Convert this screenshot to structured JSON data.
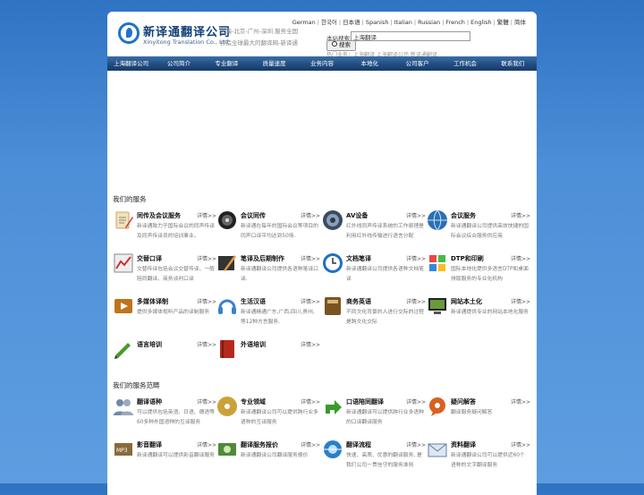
{
  "header": {
    "logo_cn": "新译通翻译公司",
    "logo_en": "Xinyitong Translation Co., Ltd",
    "slogan1": "上海-北京-广州-深圳 服务全国",
    "slogan2": "打造全球最大的翻译网-新译通",
    "languages": [
      "German",
      "한국어",
      "日本语",
      "Spanish",
      "Italian",
      "Russian",
      "French",
      "English",
      "繁體",
      "简体"
    ],
    "search_label": "本站搜索:",
    "search_value": "上海翻译",
    "search_button": "搜索",
    "hot_text": "热门业务：上海翻译 上海翻译公司 新译通翻译"
  },
  "nav": [
    "上海翻译公司",
    "公司简介",
    "专业翻译",
    "质量速度",
    "业务内容",
    "本地化",
    "公司客户",
    "工作机会",
    "联系我们"
  ],
  "sections": [
    {
      "title": "我们的服务",
      "items": [
        {
          "title": "同传及会议服务",
          "more": "详情>>",
          "desc": "新译通致力于国际会议的同声传译及同声传译员的培训事业。",
          "icon": "clipboard-icon",
          "color": "#c9a36a"
        },
        {
          "title": "会议同传",
          "more": "详情>>",
          "desc": "新译通在每年的国际会议等项目的同声口译平均达到50场.",
          "icon": "headset-icon",
          "color": "#444444"
        },
        {
          "title": "AV设备",
          "more": "详情>>",
          "desc": "红外线同声传译系统的工作原理是利用红外线传输进行语言分配",
          "icon": "speaker-icon",
          "color": "#5a6c80"
        },
        {
          "title": "会议服务",
          "more": "详情>>",
          "desc": "新译通翻译公司提供高效快捷的国际会议综合服务供应商",
          "icon": "globe-icon",
          "color": "#2a6fb5"
        },
        {
          "title": "交替口译",
          "more": "详情>>",
          "desc": "交替传译包括会议交替传译、一般陪同翻译、商务谈判口译",
          "icon": "chart-icon",
          "color": "#777777"
        },
        {
          "title": "笔译及后期制作",
          "more": "详情>>",
          "desc": "新译通翻译公司提供各语种笔译口译.",
          "icon": "pen-icon",
          "color": "#3b3b3b"
        },
        {
          "title": "文档笔译",
          "more": "详情>>",
          "desc": "新译通翻译公司提供各语种文档笔译",
          "icon": "clock-icon",
          "color": "#1e6ec8"
        },
        {
          "title": "DTP和印刷",
          "more": "详情>>",
          "desc": "国际本地化提供多语言DTP和桌面排版服务的专业化机构",
          "icon": "windows-icon",
          "color": "#2a66c7"
        },
        {
          "title": "多媒体译制",
          "more": "详情>>",
          "desc": "提供多媒体视听产品的译制服务",
          "icon": "media-icon",
          "color": "#c0731f"
        },
        {
          "title": "生活汉语",
          "more": "详情>>",
          "desc": "新译通精通广东,广西,四川,贵州,等12种方言服务.",
          "icon": "headphones-icon",
          "color": "#3a82c9"
        },
        {
          "title": "商务英语",
          "more": "详情>>",
          "desc": "不同文化背景的人进行交际的过程是跨文化交际",
          "icon": "book-icon",
          "color": "#7b5321"
        },
        {
          "title": "网站本土化",
          "more": "详情>>",
          "desc": "新译通提供专业的网站本地化服务",
          "icon": "computer-icon",
          "color": "#3f5f1f"
        },
        {
          "title": "语言培训",
          "more": "详情>>",
          "desc": "",
          "icon": "pencil-icon",
          "color": "#4a9a2b"
        },
        {
          "title": "外语培训",
          "more": "详情>>",
          "desc": "",
          "icon": "redbook-icon",
          "color": "#b52a1f"
        }
      ]
    },
    {
      "title": "我们的服务范畴",
      "items": [
        {
          "title": "翻译语种",
          "more": "详情>>",
          "desc": "可以提供包括英语、日语、德语等60多种外国语种的互译服务",
          "icon": "people-icon",
          "color": "#6f8aa8"
        },
        {
          "title": "专业领域",
          "more": "详情>>",
          "desc": "新译通翻译公司可以提供跨行业多语种的互译服务",
          "icon": "cd-icon",
          "color": "#c9a33a"
        },
        {
          "title": "口语陪同翻译",
          "more": "详情>>",
          "desc": "新译通翻译可以提供跨行业多语种的口译翻译服务",
          "icon": "arrow-icon",
          "color": "#3a9a2b"
        },
        {
          "title": "疑问解答",
          "more": "详情>>",
          "desc": "翻译服务疑问解答",
          "icon": "chat-icon",
          "color": "#d9621f"
        },
        {
          "title": "影音翻译",
          "more": "详情>>",
          "desc": "新译通翻译可以提供影音翻译服务",
          "icon": "film-icon",
          "color": "#8a6a3a"
        },
        {
          "title": "翻译服务报价",
          "more": "详情>>",
          "desc": "新译通翻译公司翻译服务报价",
          "icon": "money-icon",
          "color": "#4f8a3a"
        },
        {
          "title": "翻译流程",
          "more": "详情>>",
          "desc": "快速、高质、优惠的翻译服务, 是我们公司一贯信守的服务准则",
          "icon": "network-icon",
          "color": "#2a7fc9"
        },
        {
          "title": "资料翻译",
          "more": "详情>>",
          "desc": "新译通翻译公司可以提供近60个语种的文字翻译服务",
          "icon": "mail-icon",
          "color": "#5f7fa8"
        }
      ]
    }
  ]
}
